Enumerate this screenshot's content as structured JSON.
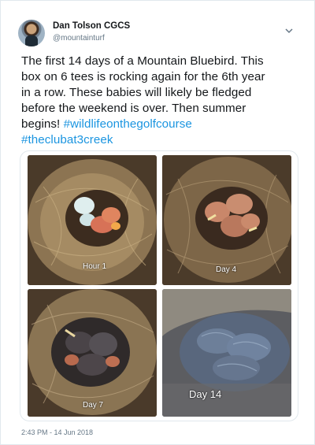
{
  "author": {
    "name": "Dan Tolson CGCS",
    "handle": "@mountainturf"
  },
  "tweet": {
    "line1": "The first 14 days of a Mountain Bluebird.  This",
    "line2": "box on 6 tees is rocking again for the 6th year",
    "line3": "in a row.  These babies will likely be fledged",
    "line4": "before the weekend is over.   Then summer",
    "line5_text": "begins!  ",
    "hashtag1": "#wildlifeonthegolfcourse",
    "hashtag2": "#theclubat3creek"
  },
  "media": {
    "photos": [
      {
        "caption": "Hour 1"
      },
      {
        "caption": "Day 4"
      },
      {
        "caption": "Day 7"
      },
      {
        "caption": "Day 14"
      }
    ]
  },
  "meta": {
    "timestamp": "2:43 PM - 14 Jun 2018"
  },
  "colors": {
    "link": "#1b95e0",
    "muted": "#657786"
  },
  "icons": {
    "menu": "chevron-down-icon"
  }
}
